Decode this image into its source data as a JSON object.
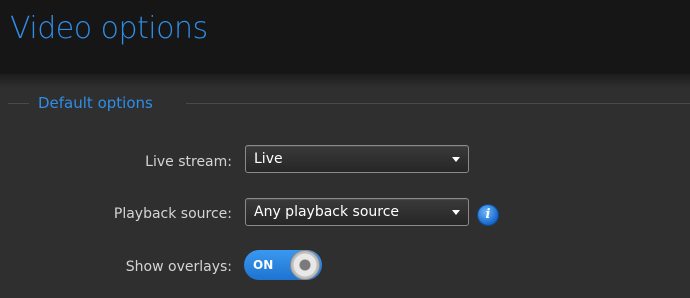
{
  "page": {
    "title": "Video options"
  },
  "group": {
    "title": "Default options"
  },
  "fields": {
    "live_stream": {
      "label": "Live stream:",
      "value": "Live"
    },
    "playback_source": {
      "label": "Playback source:",
      "value": "Any playback source"
    },
    "show_overlays": {
      "label": "Show overlays:",
      "state": "ON"
    }
  },
  "icons": {
    "info": "info-icon",
    "info_glyph": "i",
    "dropdown_arrow": "chevron-down-icon"
  },
  "colors": {
    "accent": "#2f8ee8",
    "background": "#2f2f2f",
    "header_background": "#161616",
    "toggle_on": "#2a86e2"
  }
}
